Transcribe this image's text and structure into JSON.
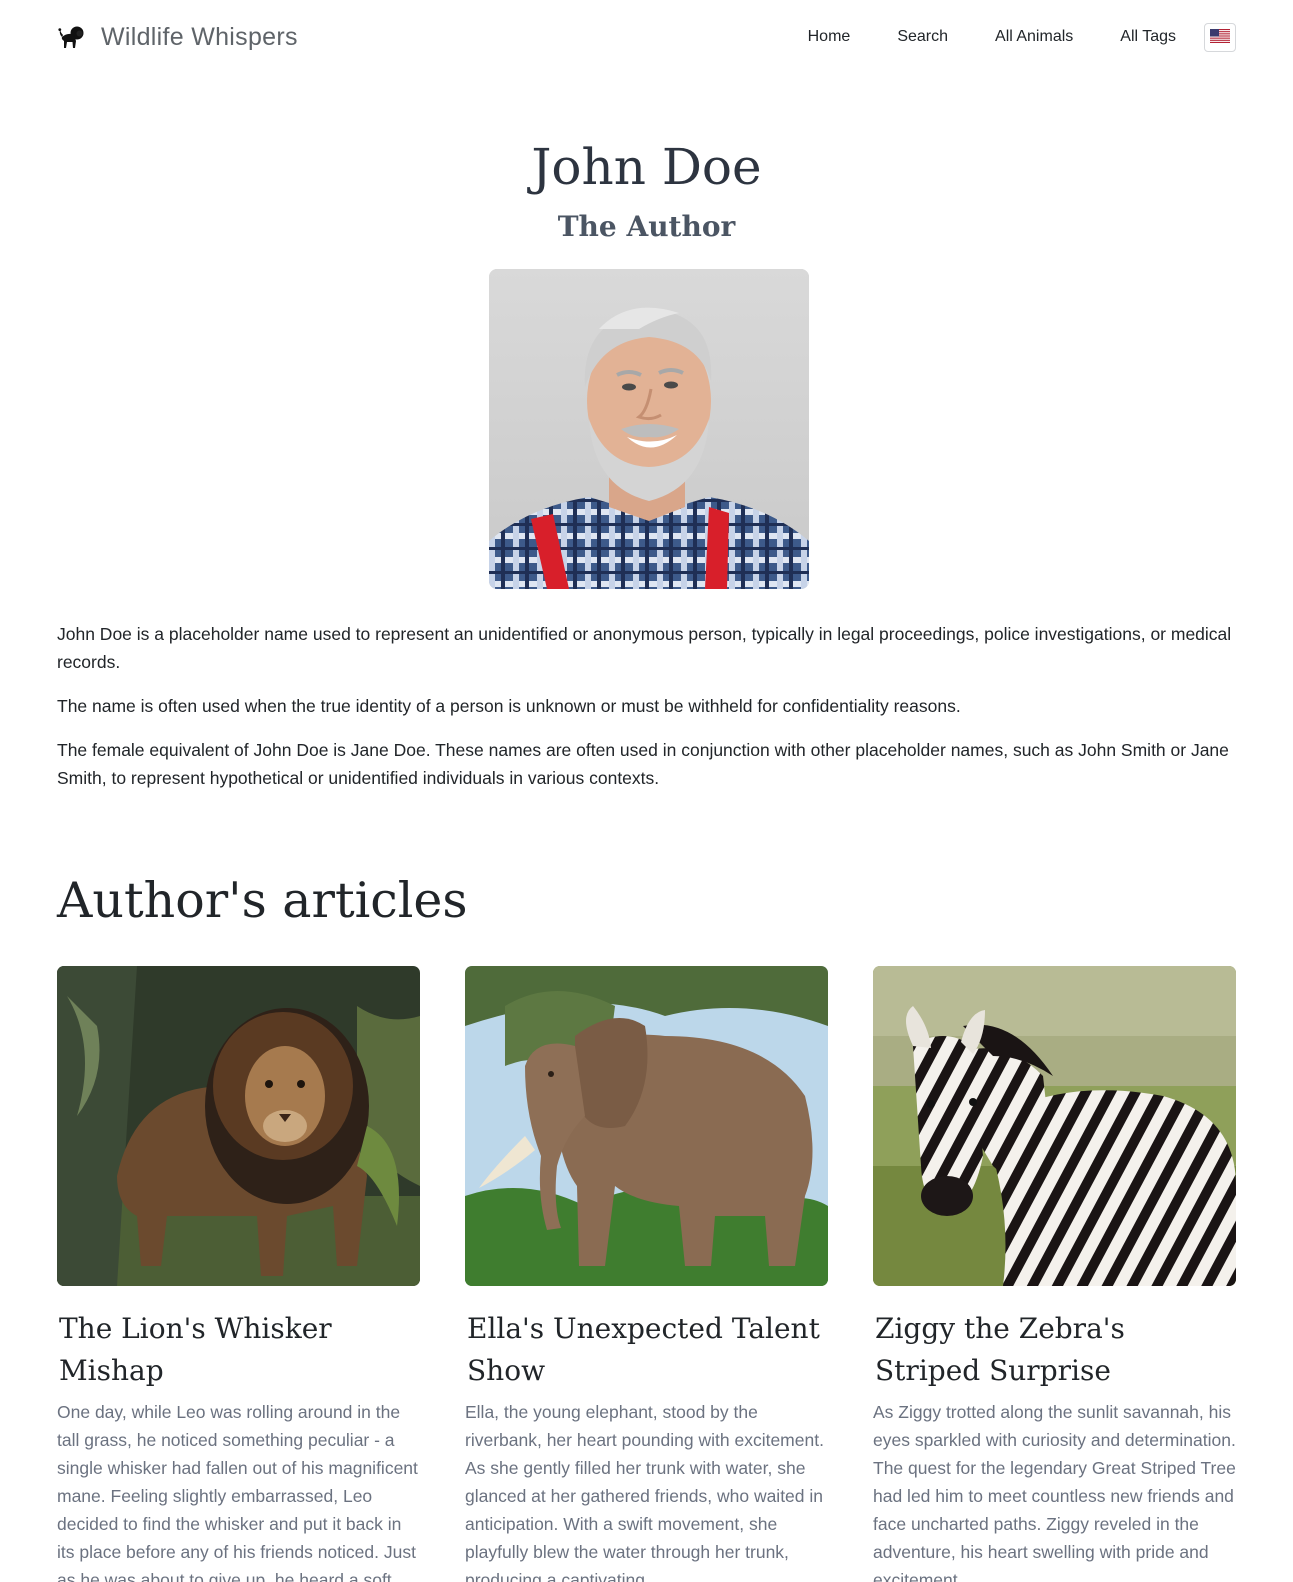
{
  "nav": {
    "brand": "Wildlife Whispers",
    "brand_icon": "lion-logo-icon",
    "links": [
      "Home",
      "Search",
      "All Animals",
      "All Tags"
    ],
    "language_icon": "us-flag-icon"
  },
  "author": {
    "name": "John Doe",
    "role": "The Author",
    "bio": [
      "John Doe is a placeholder name used to represent an unidentified or anonymous person, typically in legal proceedings, police investigations, or medical records.",
      "The name is often used when the true identity of a person is unknown or must be withheld for confidentiality reasons.",
      "The female equivalent of John Doe is Jane Doe. These names are often used in conjunction with other placeholder names, such as John Smith or Jane Smith, to represent hypothetical or unidentified individuals in various contexts."
    ]
  },
  "articles": {
    "heading": "Author's articles",
    "items": [
      {
        "title": "The Lion's Whisker Mishap",
        "excerpt": "One day, while Leo was rolling around in the tall grass, he noticed something peculiar - a single whisker had fallen out of his magnificent mane. Feeling slightly embarrassed, Leo decided to find the whisker and put it back in its place before any of his friends noticed. Just as he was about to give up, he heard a soft giggle."
      },
      {
        "title": "Ella's Unexpected Talent Show",
        "excerpt": "Ella, the young elephant, stood by the riverbank, her heart pounding with excitement. As she gently filled her trunk with water, she glanced at her gathered friends, who waited in anticipation. With a swift movement, she playfully blew the water through her trunk, producing a captivating"
      },
      {
        "title": "Ziggy the Zebra's Striped Surprise",
        "excerpt": "As Ziggy trotted along the sunlit savannah, his eyes sparkled with curiosity and determination. The quest for the legendary Great Striped Tree had led him to meet countless new friends and face uncharted paths. Ziggy reveled in the adventure, his heart swelling with pride and excitement."
      }
    ]
  }
}
